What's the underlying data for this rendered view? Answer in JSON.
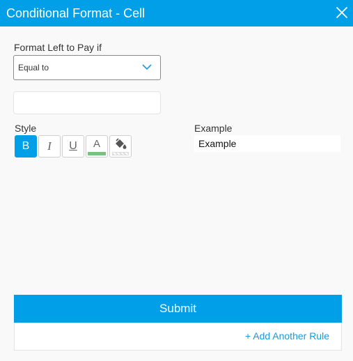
{
  "window": {
    "title": "Conditional Format - Cell"
  },
  "condition": {
    "label": "Format Left to Pay if",
    "selected": "Equal to",
    "value": "",
    "placeholder": ""
  },
  "style": {
    "label": "Style",
    "bold_label": "B",
    "italic_label": "I",
    "underline_label": "U",
    "font_color_label": "A",
    "font_color": "#79c37e",
    "bold_active": true
  },
  "example": {
    "label": "Example",
    "text": "Example"
  },
  "actions": {
    "submit_label": "Submit",
    "add_rule_label": "+ Add Another Rule"
  },
  "colors": {
    "accent": "#009fe8"
  }
}
